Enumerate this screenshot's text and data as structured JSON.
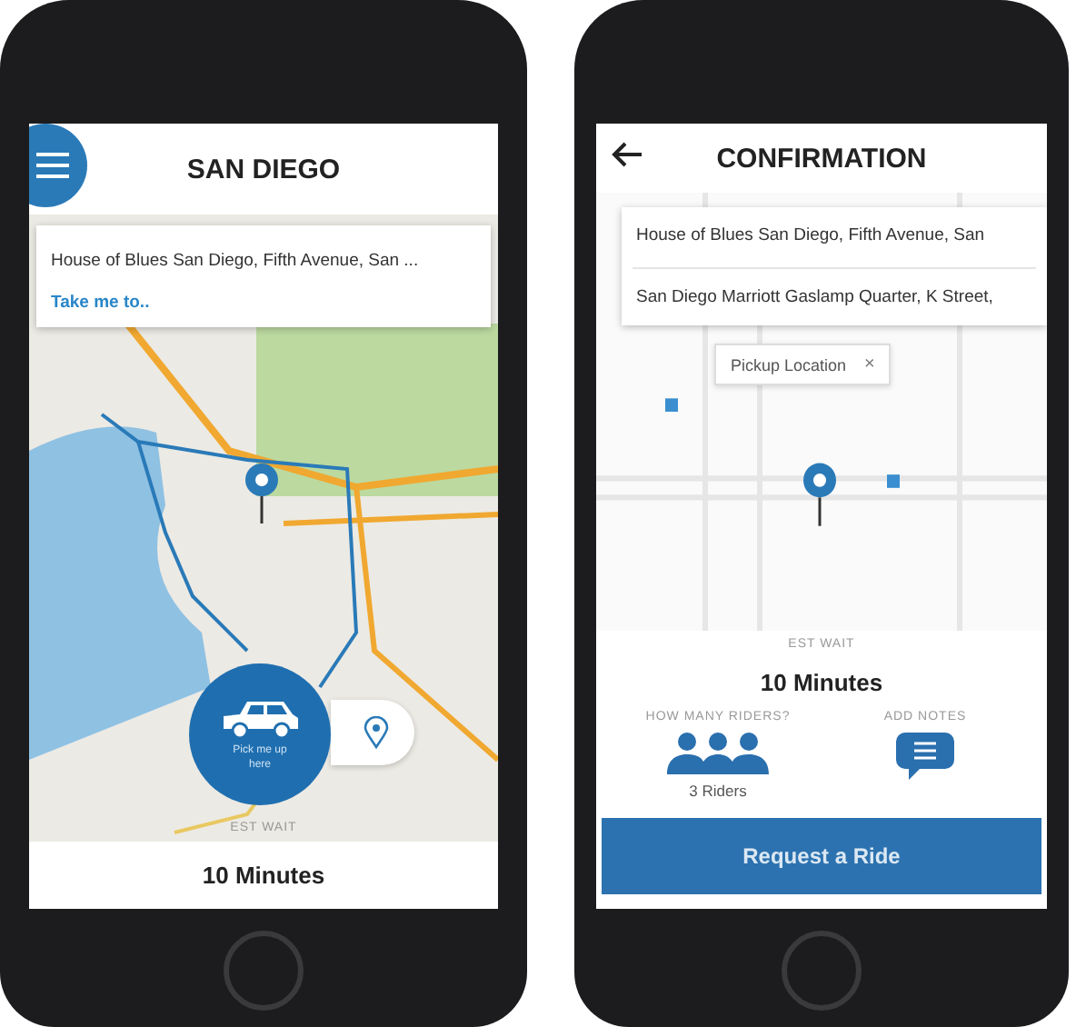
{
  "home_screen": {
    "title": "SAN DIEGO",
    "search": {
      "value": "House of Blues San Diego, Fifth Avenue, San  ...",
      "link": "Take me to.."
    },
    "pickup_button": "Pick me up here",
    "wait_label": "EST WAIT",
    "wait_time": "10 Minutes"
  },
  "confirmation_screen": {
    "title": "CONFIRMATION",
    "origin": "House of Blues San Diego, Fifth Avenue, San",
    "destination": "San Diego Marriott Gaslamp Quarter, K Street,",
    "pickup_callout": {
      "label": "Pickup Location",
      "close": "×"
    },
    "wait_label": "EST WAIT",
    "wait_time": "10 Minutes",
    "riders": {
      "label": "HOW MANY RIDERS?",
      "value": "3 Riders"
    },
    "notes": {
      "label": "ADD NOTES"
    },
    "request_button": "Request a Ride"
  }
}
